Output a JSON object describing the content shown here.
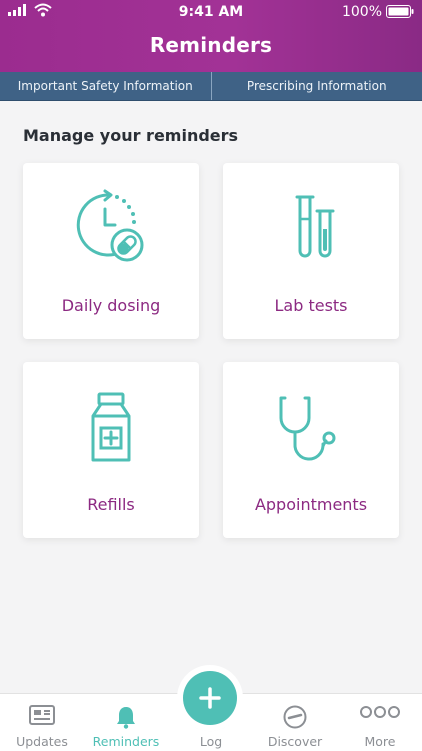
{
  "status_bar": {
    "time": "9:41 AM",
    "battery": "100%"
  },
  "header": {
    "title": "Reminders"
  },
  "info_links": {
    "safety": "Important Safety Information",
    "prescribing": "Prescribing Information"
  },
  "section": {
    "title": "Manage your reminders"
  },
  "cards": [
    {
      "label": "Daily dosing",
      "icon": "clock-pill-icon"
    },
    {
      "label": "Lab tests",
      "icon": "test-tubes-icon"
    },
    {
      "label": "Refills",
      "icon": "medicine-bottle-icon"
    },
    {
      "label": "Appointments",
      "icon": "stethoscope-icon"
    }
  ],
  "tabbar": {
    "updates": "Updates",
    "reminders": "Reminders",
    "log": "Log",
    "discover": "Discover",
    "more": "More"
  },
  "colors": {
    "header": "#9b2c8f",
    "accent": "#4fbfb5",
    "info_bar": "#3f6286",
    "card_label": "#8c2a82"
  }
}
